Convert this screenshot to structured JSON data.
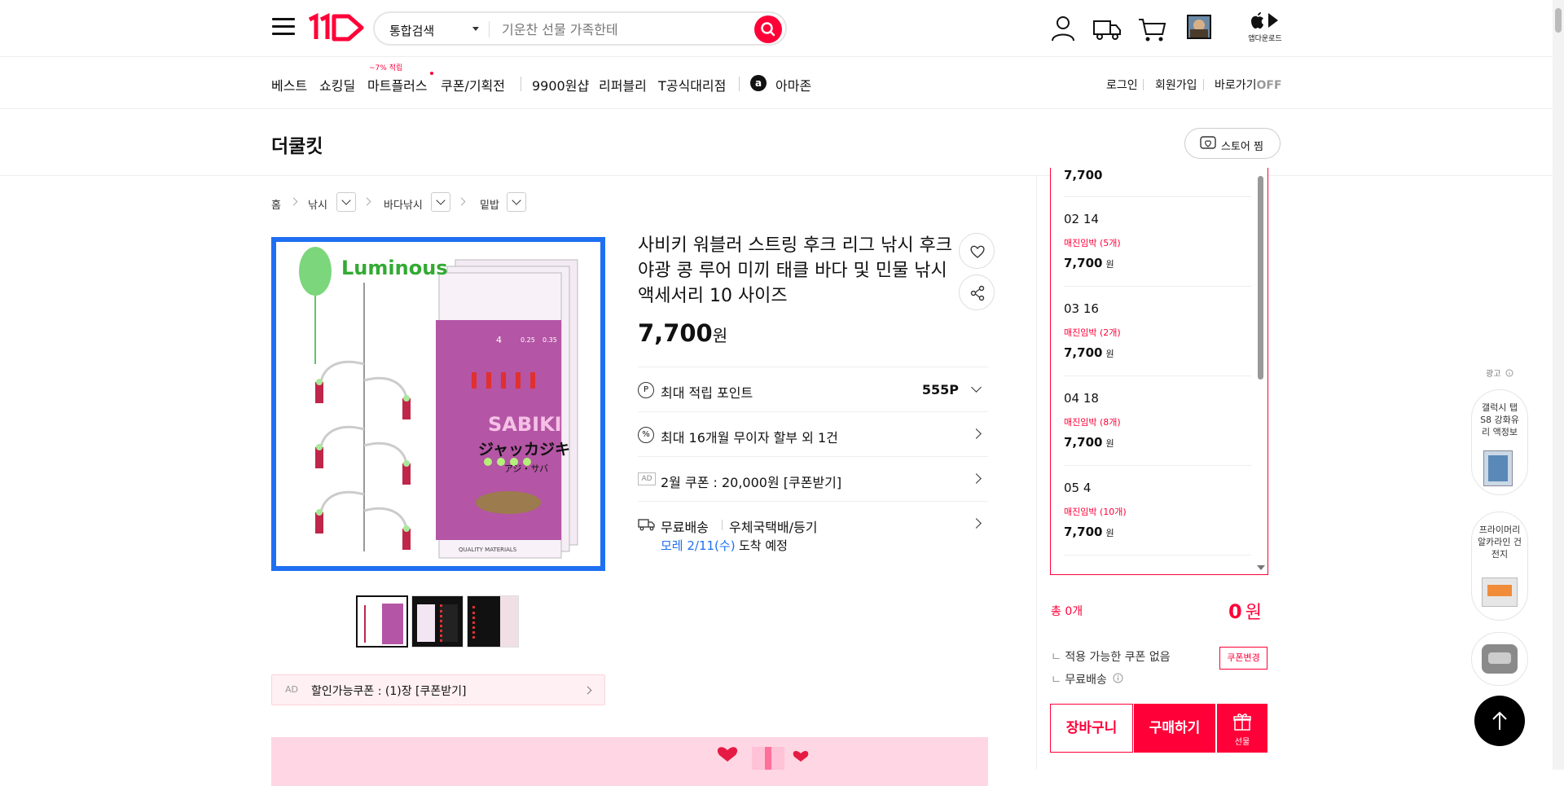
{
  "header": {
    "search_category": "통합검색",
    "search_placeholder": "기운찬 선물 가족한테",
    "app_download": "앱다운로드",
    "brand_color": "#ff0038"
  },
  "gnb": {
    "items": [
      "베스트",
      "쇼킹딜",
      "마트플러스",
      "쿠폰/기획전",
      "9900원샵",
      "리퍼블리",
      "T공식대리점",
      "아마존"
    ],
    "mart_badge": "~7% 적립",
    "login": "로그인",
    "signup": "회원가입",
    "shortcut": "바로가기",
    "shortcut_state": "OFF"
  },
  "store": {
    "name": "더쿨킷",
    "fav_label": "스토어 찜"
  },
  "breadcrumb": [
    "홈",
    "낚시",
    "바다낚시",
    "밑밥"
  ],
  "product": {
    "title": "사비키 워블러 스트링 후크 리그 낚시 후크 야광 콩 루어 미끼 태클 바다 및 민물 낚시 액세서리 10 사이즈",
    "price": "7,700",
    "price_unit": "원",
    "image_label": "Luminous",
    "pack_number": "4",
    "pack_spec1": "0.25",
    "pack_spec2": "0.35",
    "pack_brand": "SABIKI",
    "pack_jp": "ジャッカジキ",
    "pack_sub": "アジ・サバ",
    "pack_foot": "QUALITY MATERIALS"
  },
  "info_rows": {
    "points_label": "최대 적립 포인트",
    "points_value": "555P",
    "installment": "최대 16개월 무이자 할부 외 1건",
    "coupon_ad_tag": "AD",
    "coupon_ad": "2월 쿠폰 : 20,000원 [쿠폰받기]",
    "shipping": "무료배송",
    "shipping_method": "우체국택배/등기",
    "arrival_date": "모레 2/11(수)",
    "arrival_suffix": "도착 예정"
  },
  "coupon_box": {
    "tag": "AD",
    "text": "할인가능쿠폰 : (1)장 [쿠폰받기]"
  },
  "options": {
    "top_price": "7,700",
    "items": [
      {
        "name": "02 14",
        "stock": "매진임박 (5개)",
        "price": "7,700",
        "unit": "원"
      },
      {
        "name": "03 16",
        "stock": "매진임박 (2개)",
        "price": "7,700",
        "unit": "원"
      },
      {
        "name": "04 18",
        "stock": "매진임박 (8개)",
        "price": "7,700",
        "unit": "원"
      },
      {
        "name": "05 4",
        "stock": "매진임박 (10개)",
        "price": "7,700",
        "unit": "원"
      }
    ]
  },
  "purchase": {
    "total_label": "총 0개",
    "total_price": "0",
    "total_unit": "원",
    "coupon_none": "적용 가능한 쿠폰 없음",
    "coupon_change": "쿠폰변경",
    "free_shipping": "무료배송",
    "cart": "장바구니",
    "buy": "구매하기",
    "gift": "선물"
  },
  "side_ads": {
    "label": "광고",
    "items": [
      "갤럭시 탭 S8 강화유리 액정보",
      "프라이머리 알카라인 건전지"
    ]
  }
}
